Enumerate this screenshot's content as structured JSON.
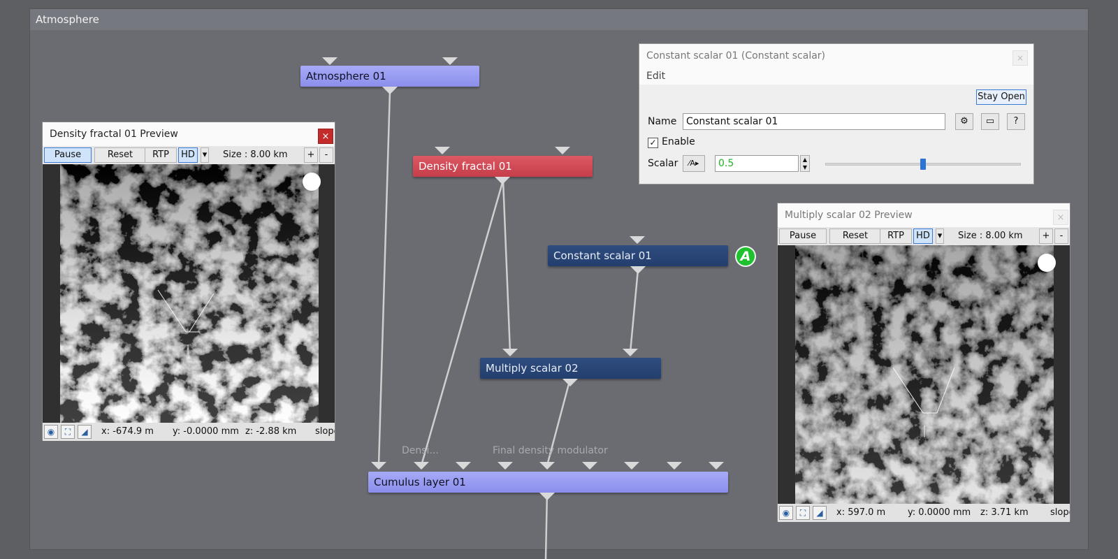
{
  "window": {
    "title": "Atmosphere"
  },
  "nodes": {
    "atmosphere": "Atmosphere 01",
    "density_fractal": "Density fractal 01",
    "constant_scalar": "Constant scalar 01",
    "multiply_scalar": "Multiply scalar 02",
    "cumulus_layer": "Cumulus layer 01",
    "badge": "A"
  },
  "input_labels": {
    "densi": "Densi...",
    "final": "Final density modulator"
  },
  "preview_left": {
    "title": "Density fractal 01 Preview",
    "close": "×",
    "toolbar": {
      "pause": "Pause",
      "reset": "Reset",
      "rtp": "RTP",
      "hd": "HD",
      "size": "Size :  8.00 km",
      "plus": "+",
      "minus": "-"
    },
    "status": {
      "x": "x: -674.9 m",
      "y": "y: -0.0000 mm",
      "z": "z: -2.88 km",
      "slope": "slope"
    }
  },
  "preview_right": {
    "title": "Multiply scalar 02 Preview",
    "close": "×",
    "toolbar": {
      "pause": "Pause",
      "reset": "Reset",
      "rtp": "RTP",
      "hd": "HD",
      "size": "Size :  8.00 km",
      "plus": "+",
      "minus": "-"
    },
    "status": {
      "x": "x: 597.0 m",
      "y": "y: 0.0000 mm",
      "z": "z: 3.71 km",
      "slope": "slope"
    }
  },
  "properties": {
    "title": "Constant scalar 01     (Constant scalar)",
    "close": "×",
    "menu_edit": "Edit",
    "stay_open": "Stay Open",
    "name_label": "Name",
    "name_value": "Constant scalar 01",
    "enable_label": "Enable",
    "enable_check": "✓",
    "scalar_label": "Scalar",
    "scalar_value": "0.5",
    "scalar_fraction": 0.5,
    "help": "?",
    "value_color": "#21b321"
  },
  "colors": {
    "node_lavender": "#9a9ef2",
    "node_red": "#cf4a55",
    "node_navy": "#29456f",
    "badge_green": "#1fc12f"
  }
}
